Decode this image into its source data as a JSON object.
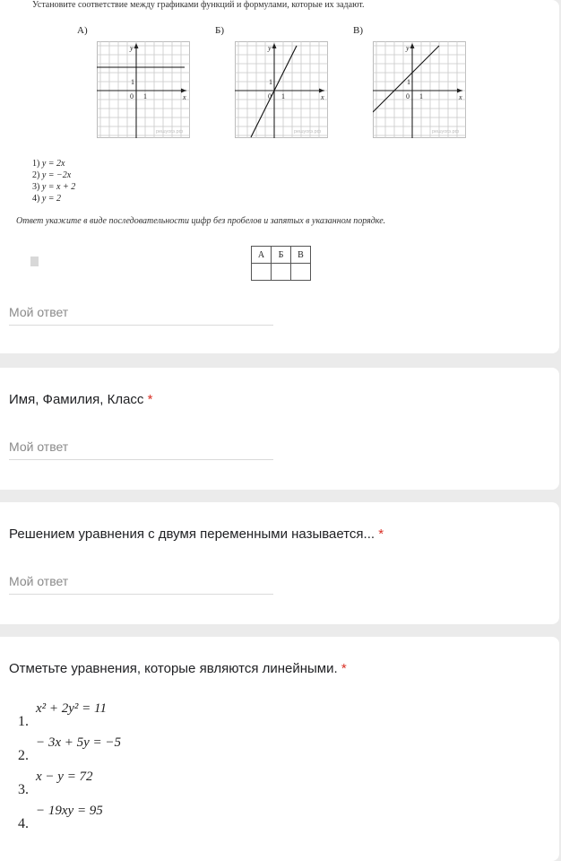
{
  "task": {
    "instruction": "Установите соответствие между графиками функций и формулами, которые их задают.",
    "graphs": [
      {
        "label": "А)",
        "line": "horizontal"
      },
      {
        "label": "Б)",
        "line": "steep"
      },
      {
        "label": "В)",
        "line": "shifted"
      }
    ],
    "axis_x": "x",
    "axis_y": "y",
    "origin": "0",
    "unit": "1",
    "watermark": "решуогэ.рф",
    "formulas": [
      {
        "num": "1)",
        "text": "y = 2x"
      },
      {
        "num": "2)",
        "text": "y = −2x"
      },
      {
        "num": "3)",
        "text": "y = x + 2"
      },
      {
        "num": "4)",
        "text": "y = 2"
      }
    ],
    "hint": "Ответ укажите в виде последовательности цифр без пробелов и запятых в указанном порядке.",
    "table_headers": [
      "А",
      "Б",
      "В"
    ]
  },
  "q1": {
    "answer_placeholder": "Мой ответ"
  },
  "q2": {
    "title": "Имя, Фамилия, Класс",
    "required_mark": "*",
    "answer_placeholder": "Мой ответ"
  },
  "q3": {
    "title": "Решением уравнения с двумя переменными называется...",
    "required_mark": "*",
    "answer_placeholder": "Мой ответ"
  },
  "q4": {
    "title": "Отметьте уравнения, которые являются линейными.",
    "required_mark": "*",
    "equations": [
      {
        "num": "1.",
        "text": "x² + 2y² = 11"
      },
      {
        "num": "2.",
        "text": "− 3x + 5y = −5"
      },
      {
        "num": "3.",
        "text": "x − y = 72"
      },
      {
        "num": "4.",
        "text": "− 19xy = 95"
      }
    ]
  },
  "colors": {
    "required": "#d93025",
    "background": "#ebebeb",
    "card": "#ffffff",
    "placeholder": "#8a8a8a"
  }
}
